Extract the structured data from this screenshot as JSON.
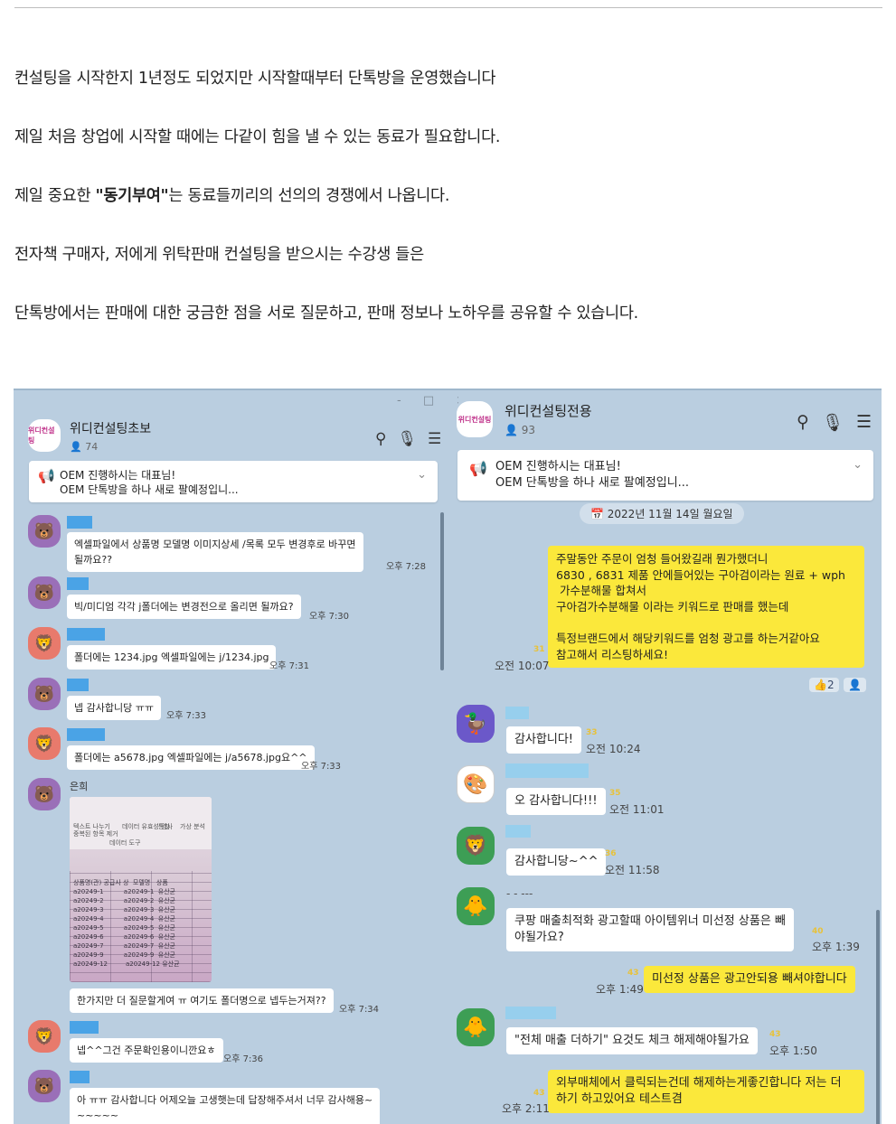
{
  "article": {
    "p1": "컨설팅을 시작한지 1년정도 되었지만 시작할때부터 단톡방을 운영했습니다",
    "p2": "제일 처음 창업에 시작할 때에는 다같이 힘을 낼 수 있는 동료가 필요합니다.",
    "p3_pre": "제일 중요한 ",
    "p3_bold": "\"동기부여\"",
    "p3_post": "는 동료들끼리의 선의의 경쟁에서 나옵니다.",
    "p4": "전자책 구매자, 저에게 위탁판매 컨설팅을 받으시는 수강생 들은",
    "p5": "단톡방에서는 판매에 대한 궁금한 점을 서로 질문하고, 판매 정보나 노하우를 공유할 수 있습니다."
  },
  "left_room": {
    "window_controls": "- □ ×",
    "avatar_text": "위디컨설팅",
    "title": "위디컨설팅초보",
    "member_count": "74",
    "notice_line1": "OEM 진행하시는 대표님!",
    "notice_line2": "OEM 단톡방을 하나 새로 팔예정입니...",
    "messages": [
      {
        "text": "엑셀파일에서 상품명 모델명 이미지상세 /목록 모두 변경후로 바꾸면\n될까요??",
        "time": "오후 7:28"
      },
      {
        "text": "빅/미디엄 각각 j폴더에는 변경전으로 올리면 될까요?",
        "time": "오후 7:30"
      },
      {
        "text": "폴더에는 1234.jpg 엑셀파일에는 j/1234.jpg",
        "time": "오후 7:31"
      },
      {
        "text": "넵 감사합니당 ㅠㅠ",
        "time": "오후 7:33"
      },
      {
        "text": "폴더에는 a5678.jpg 엑셀파일에는 j/a5678.jpg요^^",
        "time": "오후 7:33"
      },
      {
        "text": "한가지만 더 질문할게여 ㅠ 여기도 폴더명으로 넵두는거져??",
        "time": "오후 7:34"
      },
      {
        "text": "넵^^그건 주문확인용이니깐요ㅎ",
        "time": "오후 7:36"
      },
      {
        "text": "아 ㅠㅠ 감사합니다 어제오늘 고생햇는데 답장해주셔서 너무 감사해용~\n~~~~~",
        "time": ""
      }
    ],
    "photo_sender": "은희",
    "photo_ribbon": [
      "텍스트 나누기",
      "중복된 항목 제거",
      "데이터 유효성 검사",
      "통합",
      "가상 분석",
      "데이터 도구"
    ],
    "photo_cells": "상품명(관) 공급사 상  모델명   상품\na20249-1          a20249-1  유산균\na20249-2          a20249-2  유산균\na20249-3          a20249-3  유산균\na20249-4          a20249-4  유산균\na20249-5          a20249-5  유산균\na20249-6          a20249-6  유산균\na20249-7          a20249-7  유산균\na20249-9          a20249-9  유산균\na20249-12         a20249-12 유산균"
  },
  "right_room": {
    "avatar_text": "위디컨설팅",
    "title": "위디컨설팅전용",
    "member_count": "93",
    "notice_line1": "OEM 진행하시는 대표님!",
    "notice_line2": "OEM 단톡방을 하나 새로 팔예정입니...",
    "date": "2022년 11월 14일 월요일",
    "my_msg1": "주말동안 주문이 엄청 들어왔길래 뭔가했더니\n6830 , 6831 제품 안에들어있는 구아검이라는 원료 + wph\n 가수분해물 합쳐서\n구아검가수분해물 이라는 키워드로 판매를 했는데\n\n특정브랜드에서 해당키워드를 엄청 광고를 하는거같아요\n참고해서 리스팅하세요!",
    "my_msg1_time": "오전 10:07",
    "my_msg1_unread": "31",
    "reaction_count": "2",
    "messages": [
      {
        "text": "감사합니다!",
        "time": "오전 10:24",
        "unread": "33"
      },
      {
        "text": "오 감사합니다!!!",
        "time": "오전 11:01",
        "unread": "35"
      },
      {
        "text": "감사합니당~^^",
        "time": "오전 11:58",
        "unread": "36"
      },
      {
        "text": "쿠팡 매출최적화 광고할때 아이템위너 미선정 상품은 빼\n야될가요?",
        "time": "오후 1:39",
        "unread": "40"
      },
      {
        "text": "\"전체 매출 더하기\" 요것도 체크 해제해야될가요",
        "time": "오후 1:50",
        "unread": "43"
      }
    ],
    "sender_dashes": "- - ---",
    "my_msg2": "미선정 상품은 광고안되용 빼셔야합니다",
    "my_msg2_time": "오후 1:49",
    "my_msg2_unread": "43",
    "my_msg3": "외부매체에서 클릭되는건데 해제하는게좋긴합니다 저는 더\n하기 하고있어요 테스트겸",
    "my_msg3_time": "오후 2:11",
    "my_msg3_unread": "43"
  }
}
